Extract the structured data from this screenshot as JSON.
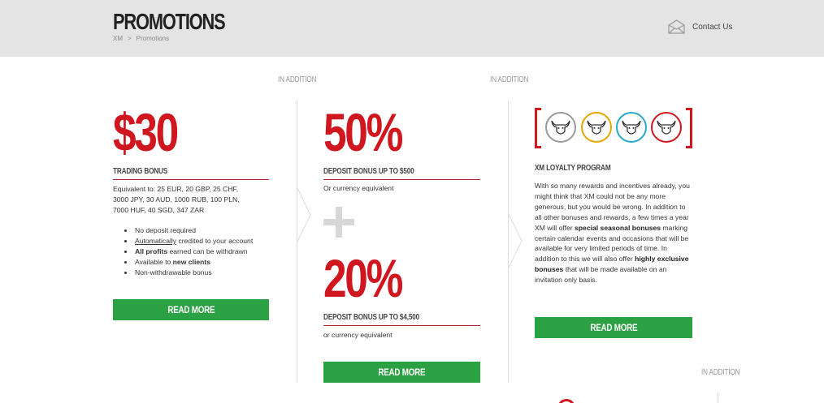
{
  "header": {
    "title": "PROMOTIONS",
    "breadcrumb": [
      "XM",
      "Promotions"
    ],
    "breadcrumb_sep": ">",
    "contact_label": "Contact Us"
  },
  "in_addition": [
    "IN ADDITION",
    "IN ADDITION",
    "IN ADDITION"
  ],
  "promo1": {
    "amount": "$30",
    "heading": "TRADING BONUS",
    "equivalent": [
      "Equivalent to: 25 EUR, 20 GBP, 25 CHF,",
      "3000 JPY, 30 AUD, 1000 RUB, 100 PLN,",
      "7000 HUF, 40 SGD, 347 ZAR"
    ],
    "bullets": {
      "b1": "No deposit required",
      "b2_link": "Automatically",
      "b2_rest": " credited to your account",
      "b3_bold": "All profits",
      "b3_rest": " earned can be withdrawn",
      "b4_pre": "Available to ",
      "b4_bold": "new clients",
      "b5": "Non-withdrawable bonus"
    },
    "button": "READ MORE"
  },
  "promo2": {
    "amount1": "50%",
    "heading1": "DEPOSIT BONUS UP TO $500",
    "sub1": "Or currency equivalent",
    "amount2": "20%",
    "heading2": "DEPOSIT BONUS UP TO $4,500",
    "sub2": "or currency equivalent",
    "button": "READ MORE"
  },
  "promo3": {
    "heading": "XM LOYALTY PROGRAM",
    "t1": "With so many rewards and incentives already, you might think that XM could not be any more generous, but you would be wrong. In addition to all other bonuses and rewards, a few times a year XM will offer ",
    "t1_bold": "special seasonal bonuses",
    "t2": " marking certain calendar events and occasions that will be available for very limited periods of time. In addition to this we will also offer ",
    "t2_bold": "highly exclusive bonuses",
    "t3": " that will be made available on an invitation only basis.",
    "button": "READ MORE",
    "mascot_colors": [
      "#9a9a9a",
      "#e8a400",
      "#2aa7c9",
      "#d0161f"
    ]
  },
  "colors": {
    "accent": "#d0161f",
    "button": "#2ca144",
    "header_bg": "#e4e4e4"
  }
}
